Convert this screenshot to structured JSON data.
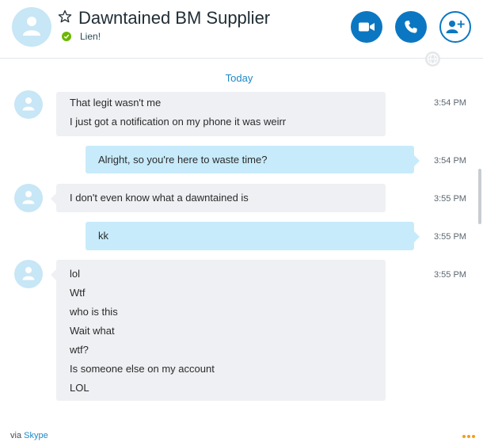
{
  "header": {
    "contact_name": "Dawntained BM Supplier",
    "status": "Lien!"
  },
  "conversation": {
    "day_label": "Today",
    "messages": [
      {
        "direction": "in",
        "time": "3:54 PM",
        "lines": [
          "That legit wasn't me",
          "I just got a notification on my phone it was weirr"
        ]
      },
      {
        "direction": "out",
        "time": "3:54 PM",
        "lines": [
          "Alright, so you're here to waste time?"
        ]
      },
      {
        "direction": "in",
        "time": "3:55 PM",
        "lines": [
          "I don't even know what a dawntained is"
        ]
      },
      {
        "direction": "out",
        "time": "3:55 PM",
        "lines": [
          "kk"
        ]
      },
      {
        "direction": "in",
        "time": "3:55 PM",
        "lines": [
          "lol",
          "Wtf",
          "who is this",
          "Wait what",
          "wtf?",
          "Is someone else on my account",
          "LOL"
        ]
      }
    ]
  },
  "footer": {
    "via_prefix": "via",
    "via_app": "Skype"
  },
  "colors": {
    "accent": "#0b77c2",
    "link": "#1e88c7",
    "presence_online": "#6bb700",
    "incoming_bubble": "#eef0f3",
    "outgoing_bubble": "#c7ebfb",
    "more_dots": "#f29d1f"
  },
  "icons": {
    "video_call": "video-camera-icon",
    "audio_call": "phone-icon",
    "add_people": "add-person-icon",
    "favorite": "star-icon",
    "globe": "globe-icon"
  }
}
